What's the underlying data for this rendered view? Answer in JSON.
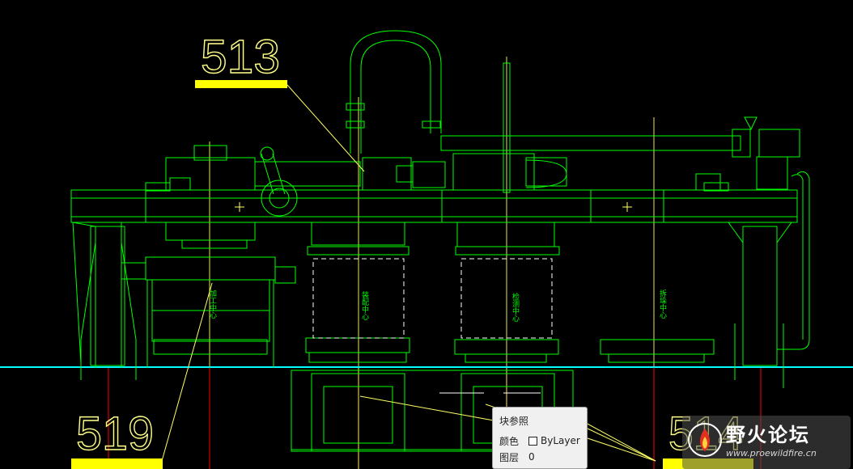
{
  "callouts": {
    "label_513": "513",
    "label_519": "519",
    "label_514": "514"
  },
  "center_labels": {
    "a": "加工中心",
    "b": "装配中心",
    "c": "检测中心",
    "d": "拆垛中心"
  },
  "tooltip": {
    "title": "块参照",
    "color_key": "颜色",
    "color_value": "ByLayer",
    "layer_key": "图层",
    "layer_value": "0"
  },
  "watermark": {
    "chinese": "野火论坛",
    "url": "www.proewildfire.cn"
  },
  "colors": {
    "background": "#000000",
    "drawing": "#00ff00",
    "leader": "#ffff00",
    "center_line": "#ff0000",
    "floor_line": "#00ffff",
    "white_lines": "#ffffff"
  }
}
